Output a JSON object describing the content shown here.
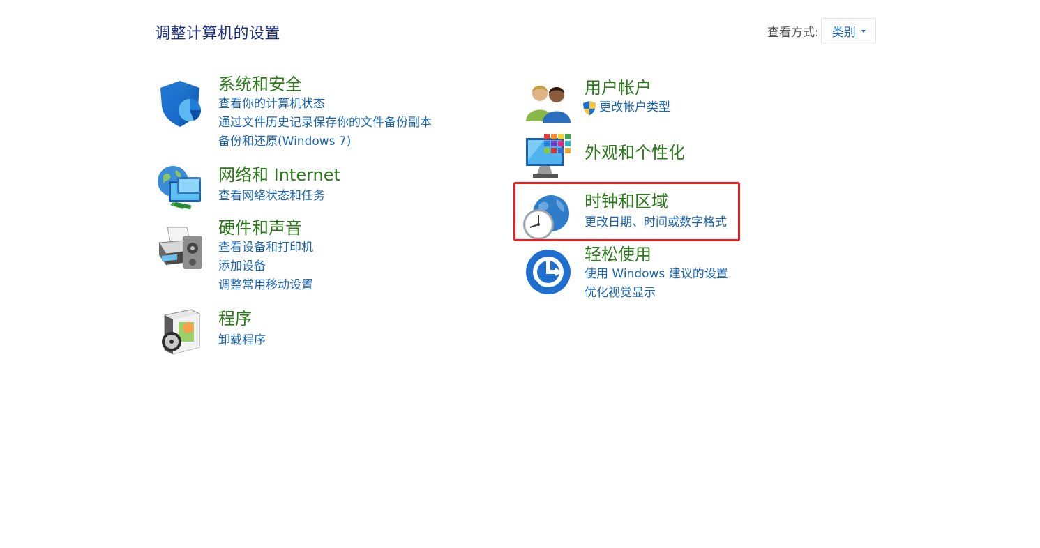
{
  "header": {
    "title": "调整计算机的设置"
  },
  "view_by": {
    "label": "查看方式:",
    "value": "类别"
  },
  "left_column": [
    {
      "title": "系统和安全",
      "icon": "shield-icon",
      "links": [
        "查看你的计算机状态",
        "通过文件历史记录保存你的文件备份副本",
        "备份和还原(Windows 7)"
      ]
    },
    {
      "title": "网络和 Internet",
      "icon": "network-icon",
      "links": [
        "查看网络状态和任务"
      ]
    },
    {
      "title": "硬件和声音",
      "icon": "printer-icon",
      "links": [
        "查看设备和打印机",
        "添加设备",
        "调整常用移动设置"
      ]
    },
    {
      "title": "程序",
      "icon": "programs-icon",
      "links": [
        "卸载程序"
      ]
    }
  ],
  "right_column": [
    {
      "title": "用户帐户",
      "icon": "users-icon",
      "links": [
        "更改帐户类型"
      ]
    },
    {
      "title": "外观和个性化",
      "icon": "display-icon",
      "links": []
    },
    {
      "title": "时钟和区域",
      "icon": "clock-globe-icon",
      "links": [
        "更改日期、时间或数字格式"
      ],
      "highlighted": true
    },
    {
      "title": "轻松使用",
      "icon": "ease-of-access-icon",
      "links": [
        "使用 Windows 建议的设置",
        "优化视觉显示"
      ]
    }
  ],
  "colors": {
    "title": "#1e3287",
    "category": "#2a7a1a",
    "link": "#1a66b3",
    "highlight": "#e5201e"
  }
}
